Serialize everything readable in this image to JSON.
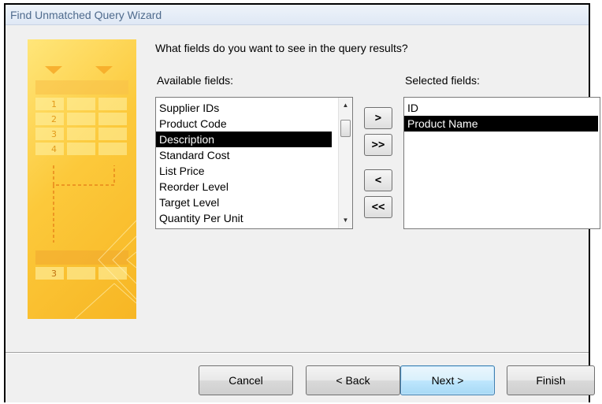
{
  "window": {
    "title": "Find Unmatched Query Wizard"
  },
  "wizard": {
    "question": "What fields do you want to see in the query results?",
    "available_label": "Available fields:",
    "selected_label": "Selected fields:",
    "available_fields": [
      "Supplier IDs",
      "Product Code",
      "Description",
      "Standard Cost",
      "List Price",
      "Reorder Level",
      "Target Level",
      "Quantity Per Unit"
    ],
    "available_selected": "Description",
    "selected_fields": [
      "ID",
      "Product Name"
    ],
    "selected_selected": "Product Name",
    "move_buttons": {
      "add": ">",
      "add_all": ">>",
      "remove": "<",
      "remove_all": "<<"
    },
    "side_art_numbers": [
      "1",
      "2",
      "3",
      "4",
      "3"
    ]
  },
  "buttons": {
    "cancel": "Cancel",
    "back": "< Back",
    "next": "Next >",
    "finish": "Finish"
  },
  "colors": {
    "art_yellow": "#fcc93b",
    "selection": "#000000",
    "title_text": "#4f6b8d"
  }
}
